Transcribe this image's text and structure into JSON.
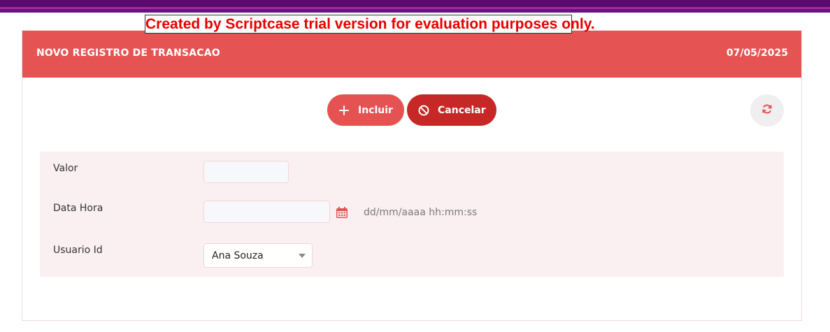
{
  "trial_banner": "Created by Scriptcase trial version for evaluation purposes only.",
  "header": {
    "title": "NOVO REGISTRO DE TRANSACAO",
    "date": "07/05/2025"
  },
  "toolbar": {
    "incluir_label": "Incluir",
    "incluir_icon": "plus-icon",
    "cancelar_label": "Cancelar",
    "cancelar_icon": "ban-icon",
    "refresh_icon": "refresh-icon"
  },
  "form": {
    "valor": {
      "label": "Valor",
      "value": ""
    },
    "data_hora": {
      "label": "Data Hora",
      "value": "",
      "format_hint": "dd/mm/aaaa hh:mm:ss",
      "icon": "calendar-icon"
    },
    "usuario_id": {
      "label": "Usuario Id",
      "selected": "Ana Souza"
    }
  },
  "colors": {
    "header_bg": "#e55353",
    "incluir_bg": "#e45252",
    "cancelar_bg": "#c62828",
    "form_bg": "#fbf0f1",
    "top_bar": "#5a0a6e",
    "banner_text": "#e60000"
  }
}
